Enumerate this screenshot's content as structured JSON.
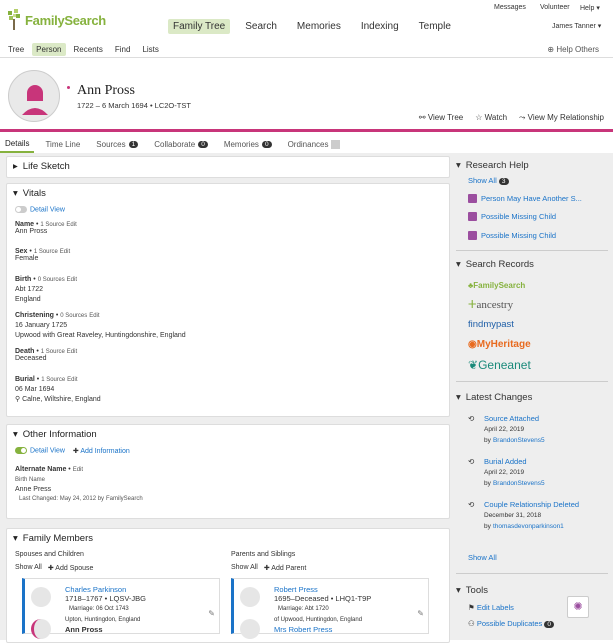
{
  "top": {
    "logo": "FamilySearch",
    "messages": "Messages",
    "volunteer": "Volunteer",
    "help": "Help ▾",
    "user": "James Tanner ▾"
  },
  "nav": [
    "Family Tree",
    "Search",
    "Memories",
    "Indexing",
    "Temple"
  ],
  "subnav": [
    "Tree",
    "Person",
    "Recents",
    "Find",
    "Lists"
  ],
  "help_others": "Help Others",
  "person": {
    "name": "Ann Pross",
    "dates": "1722 – 6 March 1694 • LC2O-TST"
  },
  "actions": {
    "view_tree": "View Tree",
    "watch": "Watch",
    "view_rel": "View My Relationship"
  },
  "tabs": [
    {
      "label": "Details"
    },
    {
      "label": "Time Line"
    },
    {
      "label": "Sources",
      "badge": "1"
    },
    {
      "label": "Collaborate",
      "badge": "0"
    },
    {
      "label": "Memories",
      "badge": "0"
    },
    {
      "label": "Ordinances"
    }
  ],
  "life_sketch": "Life Sketch",
  "vitals": {
    "title": "Vitals",
    "detail_view": "Detail View",
    "name": {
      "label": "Name",
      "src": "1 Source",
      "edit": "Edit",
      "value": "Ann Pross"
    },
    "sex": {
      "label": "Sex",
      "src": "1 Source",
      "edit": "Edit",
      "value": "Female"
    },
    "birth": {
      "label": "Birth",
      "src": "0 Sources",
      "edit": "Edit",
      "value": "Abt 1722",
      "place": "England"
    },
    "christening": {
      "label": "Christening",
      "src": "0 Sources",
      "edit": "Edit",
      "value": "16 January 1725",
      "place": "Upwood with Great Raveley, Huntingdonshire, England"
    },
    "death": {
      "label": "Death",
      "src": "1 Source",
      "edit": "Edit",
      "value": "Deceased"
    },
    "burial": {
      "label": "Burial",
      "src": "1 Source",
      "edit": "Edit",
      "value": "06 Mar 1694",
      "place": "Calne, Wiltshire, England"
    }
  },
  "other": {
    "title": "Other Information",
    "detail_view": "Detail View",
    "add_info": "Add Information",
    "alt_label": "Alternate Name",
    "edit": "Edit",
    "birth_name": "Birth Name",
    "alt_value": "Anne Press",
    "last_changed": "Last Changed: May 24, 2012 by",
    "by": "FamilySearch"
  },
  "family": {
    "title": "Family Members",
    "spouses": "Spouses and Children",
    "parents": "Parents and Siblings",
    "show_all": "Show All",
    "add_spouse": "Add Spouse",
    "add_parent": "Add Parent",
    "charles": {
      "name": "Charles Parkinson",
      "dates": "1718–1767 • LQSV-JBG",
      "marriage": "Marriage: 06 Oct 1743",
      "place": "Upton, Huntingdon, England"
    },
    "ann": {
      "name": "Ann Pross"
    },
    "robert": {
      "name": "Robert Press",
      "dates": "1695–Deceased • LHQ1-T9P",
      "marriage": "Marriage: Abt 1720",
      "place": "of Upwood, Huntingdon, England"
    },
    "mrs": {
      "name": "Mrs Robert Press"
    }
  },
  "research": {
    "title": "Research Help",
    "show_all": "Show All",
    "count": "3",
    "items": [
      "Person May Have Another S...",
      "Possible Missing Child",
      "Possible Missing Child"
    ]
  },
  "search_records": {
    "title": "Search Records",
    "sites": [
      "FamilySearch",
      "ancestry",
      "findmypast",
      "MyHeritage",
      "Geneanet"
    ]
  },
  "changes": {
    "title": "Latest Changes",
    "items": [
      {
        "title": "Source Attached",
        "date": "April 22, 2019",
        "by": "by",
        "user": "BrandonStevens5"
      },
      {
        "title": "Burial Added",
        "date": "April 22, 2019",
        "by": "by",
        "user": "BrandonStevens5"
      },
      {
        "title": "Couple Relationship Deleted",
        "date": "December 31, 2018",
        "by": "by",
        "user": "thomasdevonparkinson1"
      }
    ],
    "show_all": "Show All"
  },
  "tools": {
    "title": "Tools",
    "items": [
      "Edit Labels",
      "Possible Duplicates"
    ],
    "dup_count": "0"
  },
  "colors": {
    "green": "#86b23e",
    "pink": "#c8357a",
    "link": "#1a73c8",
    "purple": "#9b4e9f"
  }
}
